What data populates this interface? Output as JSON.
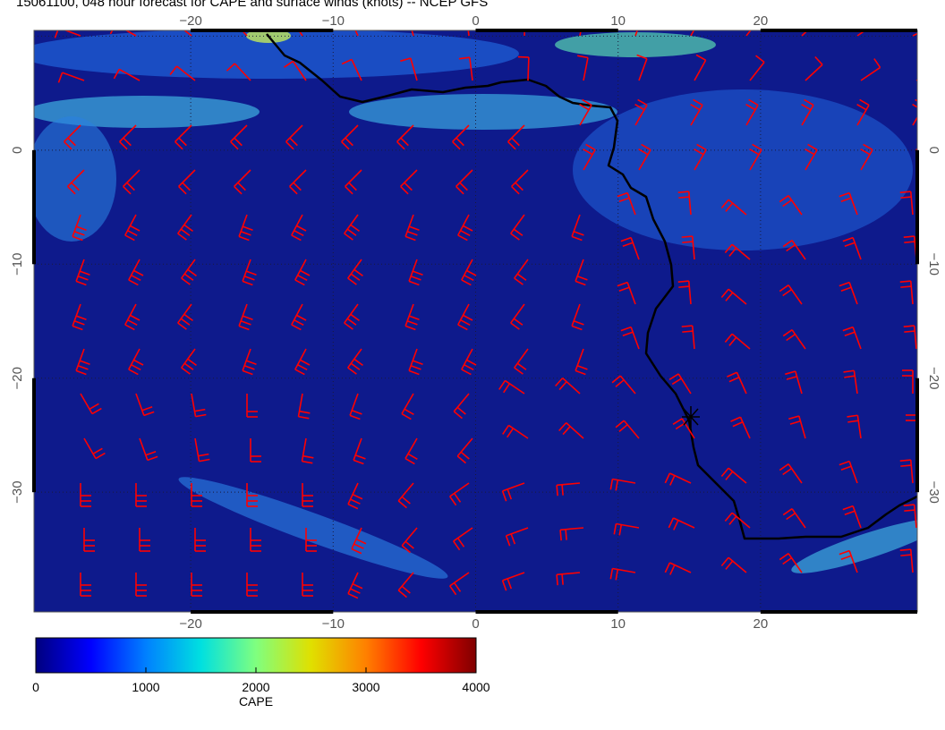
{
  "title": "15061100, 048 hour forecast for CAPE and surface winds (knots) -- NCEP GFS",
  "chart_data": {
    "type": "heatmap",
    "variable": "CAPE",
    "overlay": "surface wind barbs (knots)",
    "lon_range": [
      -31,
      31
    ],
    "lat_range": [
      -40.5,
      10.5
    ],
    "lon_ticks": [
      -20,
      -10,
      0,
      10,
      20
    ],
    "lat_ticks": [
      0,
      -10,
      -20,
      -30
    ],
    "colorbar": {
      "label": "CAPE",
      "range": [
        0,
        4000
      ],
      "ticks": [
        "0",
        "1000",
        "2000",
        "3000",
        "4000"
      ],
      "colormap": [
        "#00007f",
        "#0000ff",
        "#0080ff",
        "#00e0e0",
        "#7fff7f",
        "#e0e000",
        "#ff8000",
        "#ff0000",
        "#7f0000"
      ]
    },
    "background_color": "#0e1a8c",
    "barb_color": "#ff0000",
    "coast_color": "#000000",
    "marker": {
      "lon": 15,
      "lat": -23
    }
  }
}
